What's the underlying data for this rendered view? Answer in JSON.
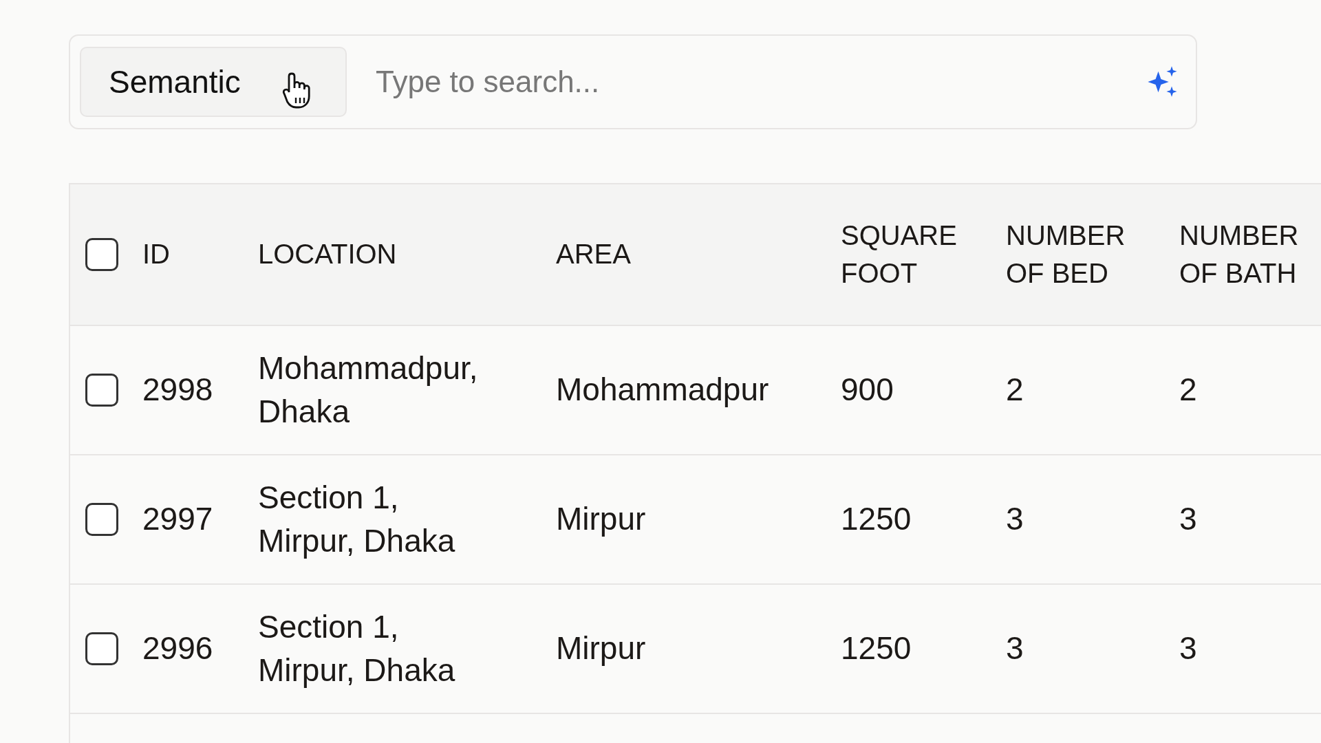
{
  "search": {
    "mode_button": "Semantic",
    "placeholder": "Type to search..."
  },
  "table": {
    "header_checked": false,
    "columns": [
      "ID",
      "LOCATION",
      "AREA",
      "SQUARE FOOT",
      "NUMBER OF BED",
      "NUMBER OF BATH"
    ],
    "rows": [
      {
        "checked": false,
        "cells": [
          "2998",
          "Mohammadpur, Dhaka",
          "Mohammadpur",
          "900",
          "2",
          "2"
        ]
      },
      {
        "checked": false,
        "cells": [
          "2997",
          "Section 1, Mirpur, Dhaka",
          "Mirpur",
          "1250",
          "3",
          "3"
        ]
      },
      {
        "checked": false,
        "cells": [
          "2996",
          "Section 1, Mirpur, Dhaka",
          "Mirpur",
          "1250",
          "3",
          "3"
        ]
      }
    ]
  }
}
